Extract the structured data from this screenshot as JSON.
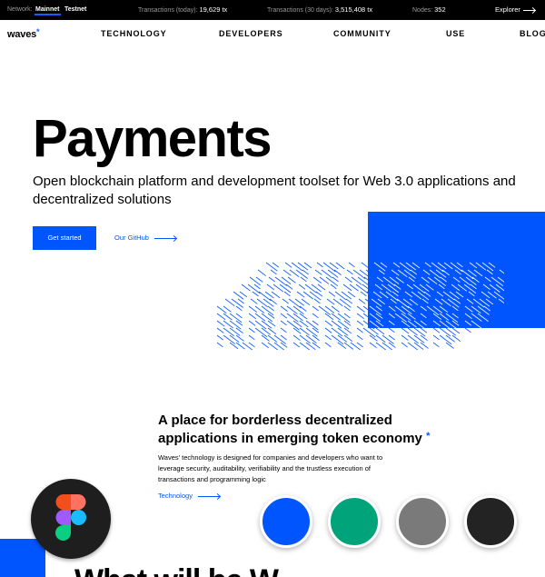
{
  "topbar": {
    "network_label": "Network:",
    "networks": [
      "Mainnet",
      "Testnet"
    ],
    "stats": [
      {
        "label": "Transactions (today):",
        "value": "19,629 tx"
      },
      {
        "label": "Transactions (30 days):",
        "value": "3,515,408 tx"
      },
      {
        "label": "Nodes:",
        "value": "352"
      }
    ],
    "explorer_label": "Explorer"
  },
  "nav": {
    "logo": "waves",
    "logo_mark": "*",
    "items": [
      "TECHNOLOGY",
      "DEVELOPERS",
      "COMMUNITY",
      "USE",
      "BLOG"
    ]
  },
  "hero": {
    "title": "Payments",
    "subtitle": "Open blockchain platform and development toolset for Web 3.0 applications and decentralized solutions",
    "primary_button": "Get started",
    "secondary_link": "Our GitHub"
  },
  "section2": {
    "title": "A place for borderless decentralized applications in emerging token economy",
    "title_mark": "*",
    "body": "Waves' technology is designed for companies and developers who want to leverage security, auditability, verifiability and the trustless execution of transactions and programming logic",
    "link": "Technology"
  },
  "overlay": {
    "badge_icon": "figma-icon",
    "swatches": [
      "#0055ff",
      "#00a37a",
      "#7a7a7a",
      "#232323"
    ]
  },
  "bottom": {
    "heading": "What will be W"
  },
  "colors": {
    "accent": "#0055ff",
    "topbar_bg": "#000000"
  }
}
